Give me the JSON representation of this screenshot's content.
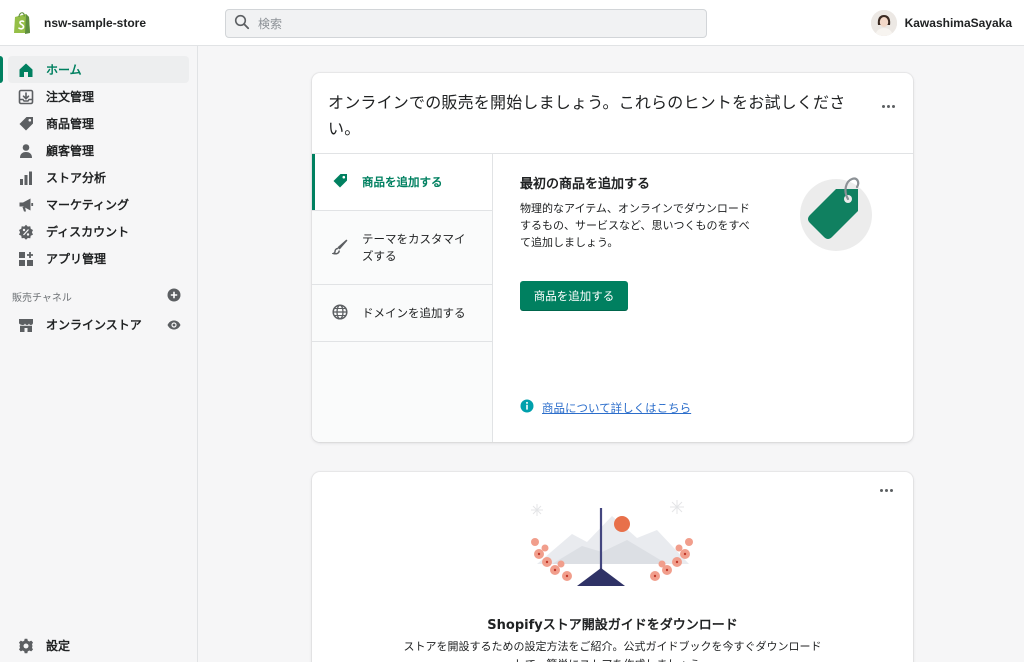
{
  "topbar": {
    "store_name": "nsw-sample-store",
    "search_placeholder": "検索",
    "user_name": "KawashimaSayaka",
    "brand_color": "#95BF47"
  },
  "sidebar": {
    "items": [
      {
        "label": "ホーム",
        "icon": "home-icon",
        "active": true
      },
      {
        "label": "注文管理",
        "icon": "orders-icon"
      },
      {
        "label": "商品管理",
        "icon": "tag-icon"
      },
      {
        "label": "顧客管理",
        "icon": "person-icon"
      },
      {
        "label": "ストア分析",
        "icon": "analytics-icon"
      },
      {
        "label": "マーケティング",
        "icon": "megaphone-icon"
      },
      {
        "label": "ディスカウント",
        "icon": "discount-icon"
      },
      {
        "label": "アプリ管理",
        "icon": "apps-icon"
      }
    ],
    "channels_heading": "販売チャネル",
    "channels": [
      {
        "label": "オンラインストア",
        "icon": "store-icon"
      }
    ],
    "settings_label": "設定",
    "accent_color": "#008060"
  },
  "setup_card": {
    "title": "オンラインでの販売を開始しましょう。これらのヒントをお試しください。",
    "tabs": [
      {
        "label": "商品を追加する",
        "icon": "tag-icon",
        "active": true
      },
      {
        "label": "テーマをカスタマイズする",
        "icon": "brush-icon"
      },
      {
        "label": "ドメインを追加する",
        "icon": "globe-icon"
      }
    ],
    "content": {
      "title": "最初の商品を追加する",
      "description": "物理的なアイテム、オンラインでダウンロードするもの、サービスなど、思いつくものをすべて追加しましょう。",
      "button_label": "商品を追加する",
      "learn_more_label": "商品について詳しくはこちら"
    }
  },
  "guide_card": {
    "title": "Shopifyストア開設ガイドをダウンロード",
    "description": "ストアを開設するための設定方法をご紹介。公式ガイドブックを今すぐダウンロードして、簡単にストアを作成しましょう。"
  }
}
